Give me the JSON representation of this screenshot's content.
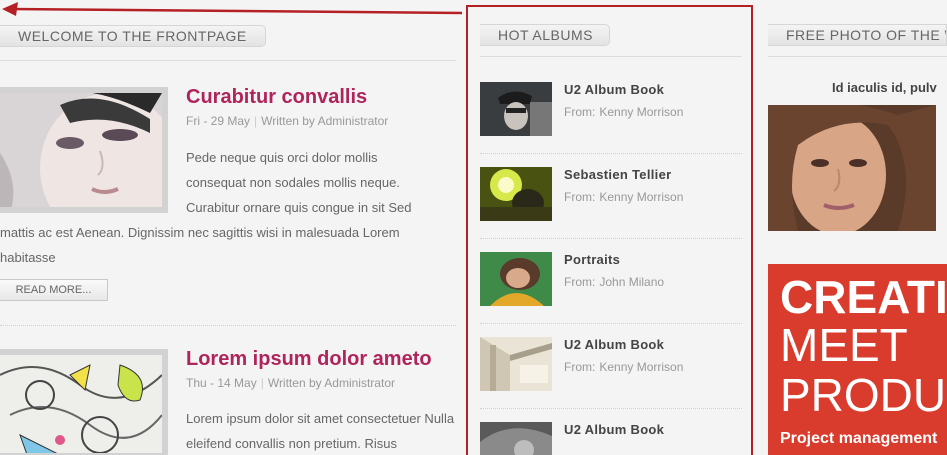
{
  "left": {
    "header": "WELCOME TO THE FRONTPAGE",
    "articles": [
      {
        "title": "Curabitur convallis",
        "date": "Fri - 29 May",
        "author": "Written by Administrator",
        "text": "Pede neque quis orci dolor mollis consequat non sodales mollis neque. Curabitur ornare quis congue in sit Sed mattis ac est Aenean. Dignissim nec sagittis wisi in malesuada Lorem habitasse",
        "read_more": "READ MORE..."
      },
      {
        "title": "Lorem ipsum dolor ameto",
        "date": "Thu - 14 May",
        "author": "Written by Administrator",
        "text": "Lorem ipsum dolor sit amet consectetuer Nulla eleifend convallis non pretium. Risus"
      }
    ]
  },
  "middle": {
    "header": "HOT ALBUMS",
    "from_label": "From:",
    "albums": [
      {
        "title": "U2 Album Book",
        "author": "Kenny Morrison"
      },
      {
        "title": "Sebastien Tellier",
        "author": "Kenny Morrison"
      },
      {
        "title": "Portraits",
        "author": "John Milano"
      },
      {
        "title": "U2 Album Book",
        "author": "Kenny Morrison"
      },
      {
        "title": "U2 Album Book",
        "author": ""
      }
    ]
  },
  "right": {
    "header": "FREE PHOTO OF THE W",
    "caption": "Id iaculis id, pulv",
    "banner": {
      "line1": "CREATIV",
      "line2": "MEET",
      "line3": "PRODUC",
      "line4": "Project management"
    }
  },
  "colors": {
    "accent_title": "#b0245c",
    "highlight_border": "#b52025",
    "banner_bg": "#d93b2c"
  }
}
